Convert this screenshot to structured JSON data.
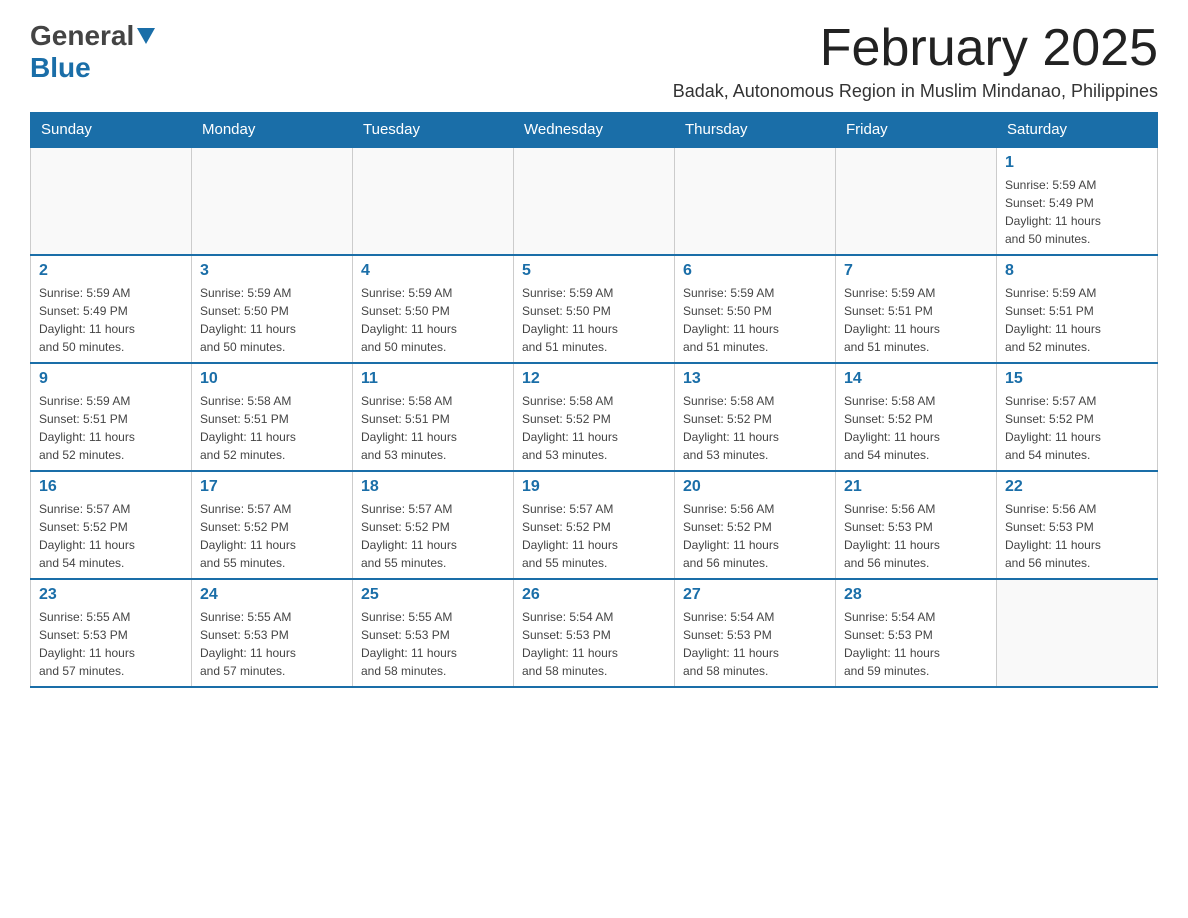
{
  "header": {
    "logo_general": "General",
    "logo_blue": "Blue",
    "title": "February 2025",
    "subtitle": "Badak, Autonomous Region in Muslim Mindanao, Philippines"
  },
  "weekdays": [
    "Sunday",
    "Monday",
    "Tuesday",
    "Wednesday",
    "Thursday",
    "Friday",
    "Saturday"
  ],
  "weeks": [
    [
      {
        "day": "",
        "info": ""
      },
      {
        "day": "",
        "info": ""
      },
      {
        "day": "",
        "info": ""
      },
      {
        "day": "",
        "info": ""
      },
      {
        "day": "",
        "info": ""
      },
      {
        "day": "",
        "info": ""
      },
      {
        "day": "1",
        "info": "Sunrise: 5:59 AM\nSunset: 5:49 PM\nDaylight: 11 hours\nand 50 minutes."
      }
    ],
    [
      {
        "day": "2",
        "info": "Sunrise: 5:59 AM\nSunset: 5:49 PM\nDaylight: 11 hours\nand 50 minutes."
      },
      {
        "day": "3",
        "info": "Sunrise: 5:59 AM\nSunset: 5:50 PM\nDaylight: 11 hours\nand 50 minutes."
      },
      {
        "day": "4",
        "info": "Sunrise: 5:59 AM\nSunset: 5:50 PM\nDaylight: 11 hours\nand 50 minutes."
      },
      {
        "day": "5",
        "info": "Sunrise: 5:59 AM\nSunset: 5:50 PM\nDaylight: 11 hours\nand 51 minutes."
      },
      {
        "day": "6",
        "info": "Sunrise: 5:59 AM\nSunset: 5:50 PM\nDaylight: 11 hours\nand 51 minutes."
      },
      {
        "day": "7",
        "info": "Sunrise: 5:59 AM\nSunset: 5:51 PM\nDaylight: 11 hours\nand 51 minutes."
      },
      {
        "day": "8",
        "info": "Sunrise: 5:59 AM\nSunset: 5:51 PM\nDaylight: 11 hours\nand 52 minutes."
      }
    ],
    [
      {
        "day": "9",
        "info": "Sunrise: 5:59 AM\nSunset: 5:51 PM\nDaylight: 11 hours\nand 52 minutes."
      },
      {
        "day": "10",
        "info": "Sunrise: 5:58 AM\nSunset: 5:51 PM\nDaylight: 11 hours\nand 52 minutes."
      },
      {
        "day": "11",
        "info": "Sunrise: 5:58 AM\nSunset: 5:51 PM\nDaylight: 11 hours\nand 53 minutes."
      },
      {
        "day": "12",
        "info": "Sunrise: 5:58 AM\nSunset: 5:52 PM\nDaylight: 11 hours\nand 53 minutes."
      },
      {
        "day": "13",
        "info": "Sunrise: 5:58 AM\nSunset: 5:52 PM\nDaylight: 11 hours\nand 53 minutes."
      },
      {
        "day": "14",
        "info": "Sunrise: 5:58 AM\nSunset: 5:52 PM\nDaylight: 11 hours\nand 54 minutes."
      },
      {
        "day": "15",
        "info": "Sunrise: 5:57 AM\nSunset: 5:52 PM\nDaylight: 11 hours\nand 54 minutes."
      }
    ],
    [
      {
        "day": "16",
        "info": "Sunrise: 5:57 AM\nSunset: 5:52 PM\nDaylight: 11 hours\nand 54 minutes."
      },
      {
        "day": "17",
        "info": "Sunrise: 5:57 AM\nSunset: 5:52 PM\nDaylight: 11 hours\nand 55 minutes."
      },
      {
        "day": "18",
        "info": "Sunrise: 5:57 AM\nSunset: 5:52 PM\nDaylight: 11 hours\nand 55 minutes."
      },
      {
        "day": "19",
        "info": "Sunrise: 5:57 AM\nSunset: 5:52 PM\nDaylight: 11 hours\nand 55 minutes."
      },
      {
        "day": "20",
        "info": "Sunrise: 5:56 AM\nSunset: 5:52 PM\nDaylight: 11 hours\nand 56 minutes."
      },
      {
        "day": "21",
        "info": "Sunrise: 5:56 AM\nSunset: 5:53 PM\nDaylight: 11 hours\nand 56 minutes."
      },
      {
        "day": "22",
        "info": "Sunrise: 5:56 AM\nSunset: 5:53 PM\nDaylight: 11 hours\nand 56 minutes."
      }
    ],
    [
      {
        "day": "23",
        "info": "Sunrise: 5:55 AM\nSunset: 5:53 PM\nDaylight: 11 hours\nand 57 minutes."
      },
      {
        "day": "24",
        "info": "Sunrise: 5:55 AM\nSunset: 5:53 PM\nDaylight: 11 hours\nand 57 minutes."
      },
      {
        "day": "25",
        "info": "Sunrise: 5:55 AM\nSunset: 5:53 PM\nDaylight: 11 hours\nand 58 minutes."
      },
      {
        "day": "26",
        "info": "Sunrise: 5:54 AM\nSunset: 5:53 PM\nDaylight: 11 hours\nand 58 minutes."
      },
      {
        "day": "27",
        "info": "Sunrise: 5:54 AM\nSunset: 5:53 PM\nDaylight: 11 hours\nand 58 minutes."
      },
      {
        "day": "28",
        "info": "Sunrise: 5:54 AM\nSunset: 5:53 PM\nDaylight: 11 hours\nand 59 minutes."
      },
      {
        "day": "",
        "info": ""
      }
    ]
  ]
}
